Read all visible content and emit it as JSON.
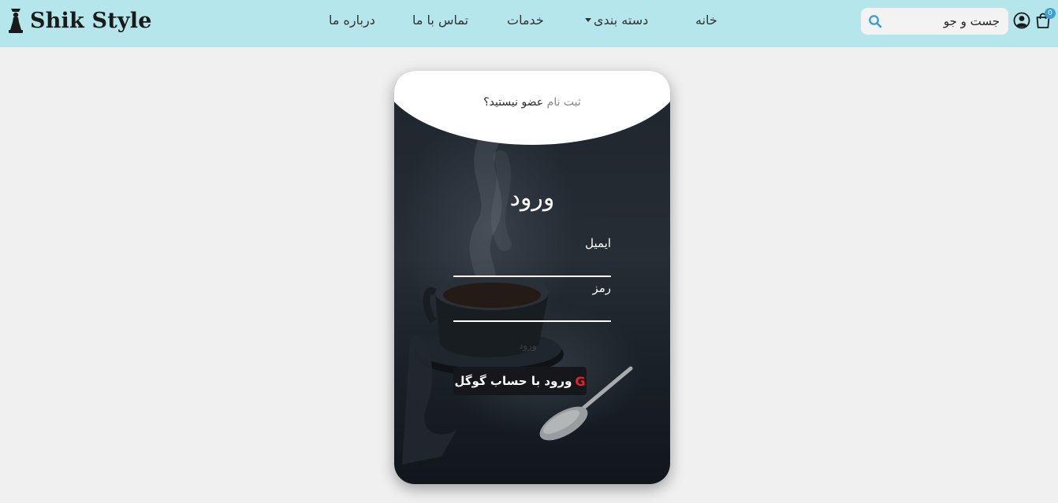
{
  "brand": {
    "name": "Shik Style"
  },
  "nav": {
    "home": "خانه",
    "categories": "دسته بندی",
    "services": "خدمات",
    "contact": "تماس با ما",
    "about": "درباره ما"
  },
  "search": {
    "placeholder": "جست و جو"
  },
  "cart": {
    "count": "0"
  },
  "card": {
    "signup_question": "عضو نیستید؟",
    "signup_link": "ثبت نام",
    "title": "ورود",
    "email_label": "ایمیل",
    "password_label": "رمز",
    "faded_text": "ورود",
    "google_letter": "G",
    "google_label": "ورود با حساب گوگل"
  },
  "icons": {
    "brand": "chess-figure-icon",
    "search": "search-icon",
    "user": "user-circle-icon",
    "cart": "shopping-bag-icon",
    "google": "google-icon"
  },
  "colors": {
    "navbar_bg": "#b4e6ec",
    "page_bg": "#f0f0f0",
    "accent": "#3aa1d6",
    "google_red": "#e8212b",
    "card_dark": "#1e252d"
  }
}
